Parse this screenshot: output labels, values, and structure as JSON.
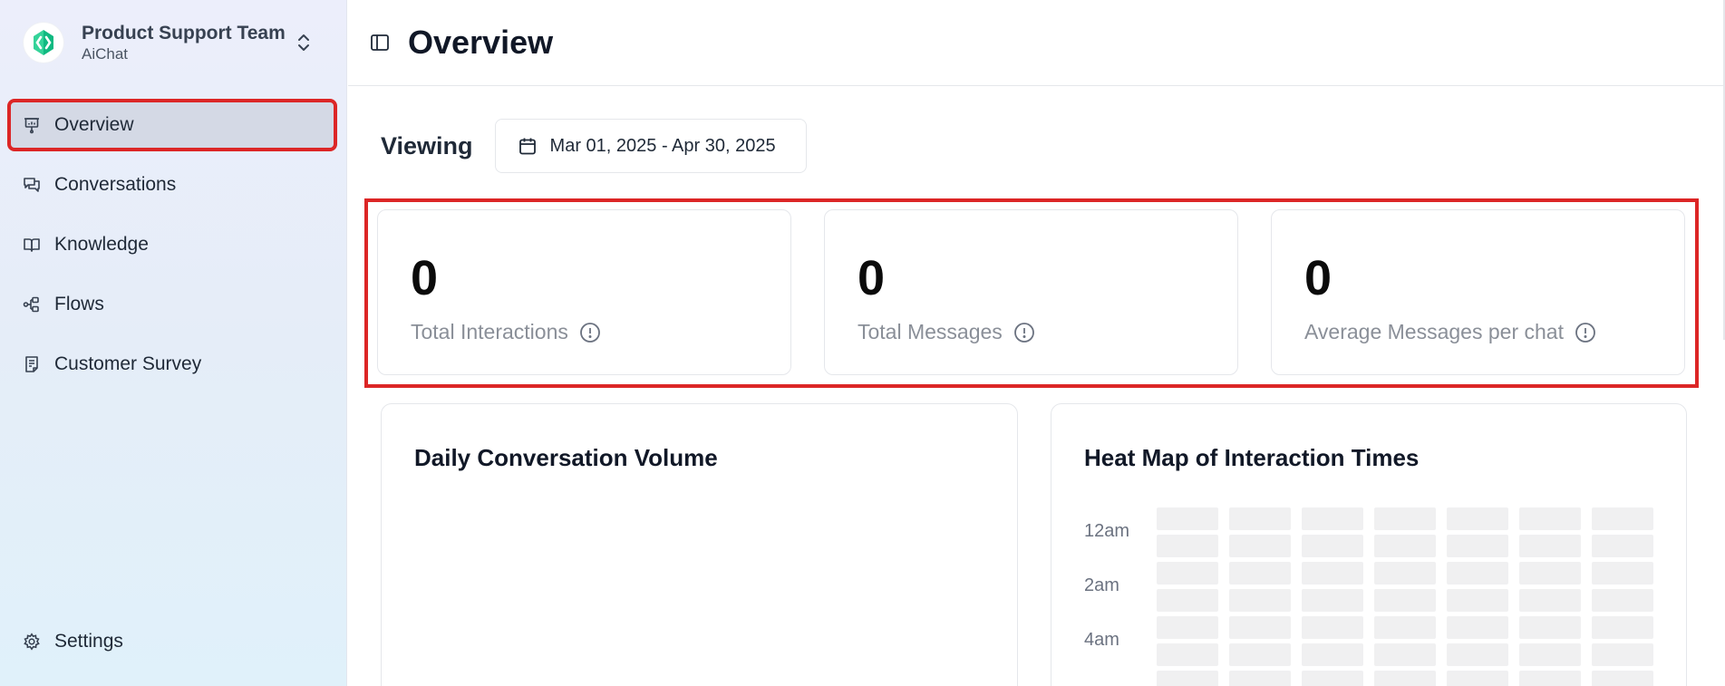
{
  "sidebar": {
    "team_name": "Product Support Team",
    "team_sub": "AiChat",
    "brand_color": "#34d399",
    "items": [
      {
        "label": "Overview",
        "icon": "presentation-icon",
        "active": true
      },
      {
        "label": "Conversations",
        "icon": "chat-icon",
        "active": false
      },
      {
        "label": "Knowledge",
        "icon": "book-icon",
        "active": false
      },
      {
        "label": "Flows",
        "icon": "flow-icon",
        "active": false
      },
      {
        "label": "Customer Survey",
        "icon": "survey-icon",
        "active": false
      }
    ],
    "settings_label": "Settings"
  },
  "header": {
    "title": "Overview"
  },
  "viewing": {
    "label": "Viewing",
    "date_range": "Mar 01, 2025 - Apr 30, 2025"
  },
  "stats": [
    {
      "value": "0",
      "label": "Total Interactions"
    },
    {
      "value": "0",
      "label": "Total Messages"
    },
    {
      "value": "0",
      "label": "Average Messages per chat"
    }
  ],
  "charts": {
    "daily_title": "Daily Conversation Volume",
    "heat_title": "Heat Map of Interaction Times",
    "heat_time_labels": [
      "12am",
      "2am",
      "4am"
    ]
  },
  "highlight_color": "#dc2626"
}
